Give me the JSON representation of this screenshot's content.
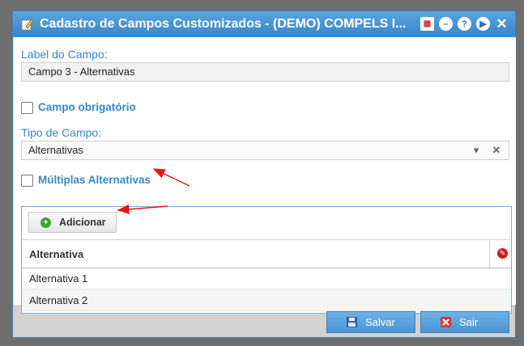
{
  "window": {
    "title": "Cadastro de Campos Customizados - (DEMO) COMPELS I...",
    "icons": [
      "calendar-icon",
      "minimize-icon",
      "help-icon",
      "play-icon",
      "close-icon"
    ]
  },
  "form": {
    "label_field_caption": "Label do Campo:",
    "label_field_value": "Campo 3 - Alternativas",
    "required_checkbox_label": "Campo obrigatório",
    "type_caption": "Tipo de Campo:",
    "type_value": "Alternativas",
    "multiple_checkbox_label": "Múltiplas Alternativas"
  },
  "alternatives": {
    "add_button_label": "Adicionar",
    "column_header": "Alternativa",
    "rows": [
      "Alternativa 1",
      "Alternativa 2"
    ]
  },
  "footer": {
    "save_label": "Salvar",
    "exit_label": "Sair"
  },
  "colors": {
    "accent": "#3a87c8",
    "title_bar": "#3a86c8"
  }
}
